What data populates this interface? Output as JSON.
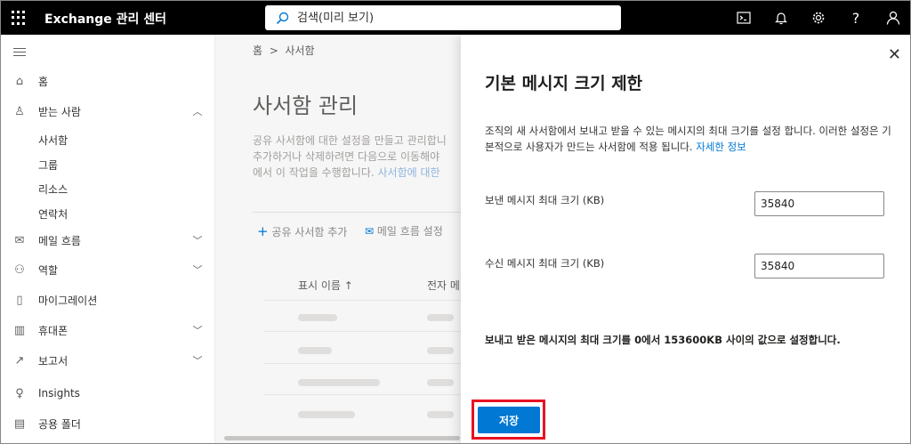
{
  "header": {
    "app_title": "Exchange 관리 센터",
    "search_placeholder": "검색(미리 보기)"
  },
  "nav": {
    "items": [
      {
        "label": "홈",
        "icon": "home-icon"
      },
      {
        "label": "받는 사람",
        "icon": "person-icon",
        "expanded": true
      },
      {
        "label": "메일 흐름",
        "icon": "mail-icon"
      },
      {
        "label": "역할",
        "icon": "roles-icon"
      },
      {
        "label": "마이그레이션",
        "icon": "migration-icon"
      },
      {
        "label": "휴대폰",
        "icon": "mobile-icon"
      },
      {
        "label": "보고서",
        "icon": "report-icon"
      },
      {
        "label": "Insights",
        "icon": "insights-icon"
      },
      {
        "label": "공용 폴더",
        "icon": "folder-icon"
      }
    ],
    "recipients_sub": [
      "사서함",
      "그룹",
      "리소스",
      "연락처"
    ]
  },
  "main": {
    "breadcrumb_home": "홈",
    "breadcrumb_current": "사서함",
    "title": "사서함 관리",
    "desc_line1": "공유 사서함에 대한 설정을 만들고 관리합니",
    "desc_line2": "추가하거나 삭제하려면 다음으로 이동해야",
    "desc_line3": "에서 이 작업을 수행합니다. ",
    "desc_link": "사서함에 대한",
    "cmd_add": "공유 사서함 추가",
    "cmd_mailflow": "메일 흐름 설정",
    "col_display_name": "표시 이름 ↑",
    "col_email": "전자 메"
  },
  "panel": {
    "title": "기본 메시지 크기 제한",
    "desc": "조직의 새 사서함에서 보내고 받을 수 있는 메시지의 최대 크기를 설정 합니다. 이러한 설정은 기본적으로 사용자가 만드는 사서함에 적용 됩니다. ",
    "desc_link": "자세한 정보",
    "send_label": "보낸 메시지 최대 크기 (KB)",
    "send_value": "35840",
    "receive_label": "수신 메시지 최대 크기 (KB)",
    "receive_value": "35840",
    "note": "보내고 받은 메시지의 최대 크기를 0에서 153600KB 사이의 값으로 설정합니다.",
    "save_label": "저장"
  }
}
